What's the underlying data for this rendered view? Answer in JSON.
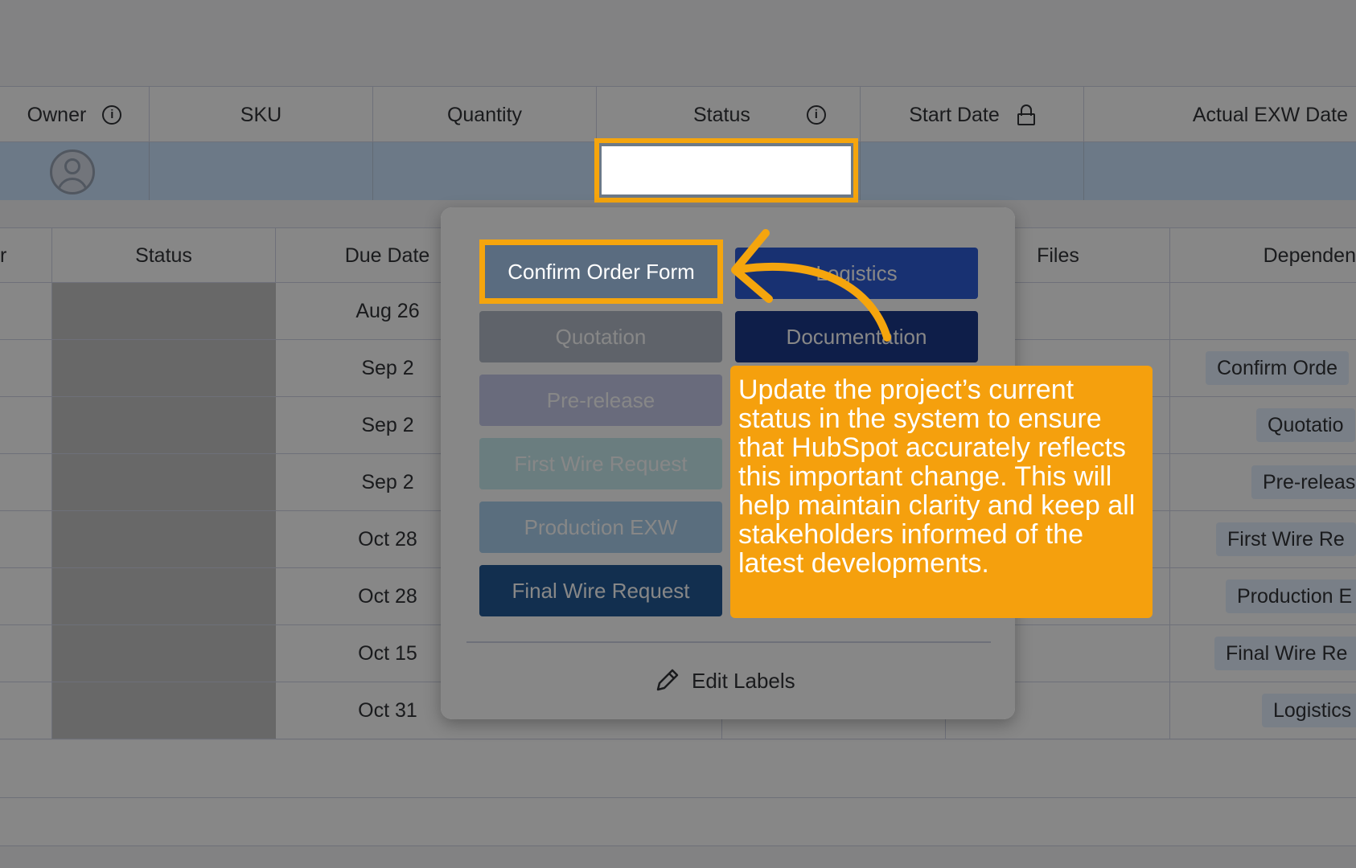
{
  "top_table": {
    "headers": {
      "owner": "Owner",
      "sku": "SKU",
      "quantity": "Quantity",
      "status": "Status",
      "start_date": "Start Date",
      "actual_exw": "Actual EXW Date"
    }
  },
  "sub_table": {
    "headers": {
      "r": "r",
      "status": "Status",
      "due_date": "Due Date",
      "files": "Files",
      "dependencies": "Dependen"
    },
    "rows": [
      {
        "due": "Aug 26",
        "dep": ""
      },
      {
        "due": "Sep 2",
        "dep": "Confirm Orde"
      },
      {
        "due": "Sep 2",
        "dep": "Quotatio"
      },
      {
        "due": "Sep 2",
        "dep": "Pre-releas"
      },
      {
        "due": "Oct 28",
        "dep": "First Wire Re"
      },
      {
        "due": "Oct 28",
        "dep": "Production E"
      },
      {
        "due": "Oct 15",
        "dep": "Final Wire Re"
      },
      {
        "due": "Oct 31",
        "dep": "Logistics"
      }
    ]
  },
  "popup": {
    "labels": [
      {
        "text": "Confirm Order Form",
        "color": "#5a6c80"
      },
      {
        "text": "Logistics",
        "color": "#2f5ed8"
      },
      {
        "text": "Quotation",
        "color": "#b4bcc8"
      },
      {
        "text": "Documentation",
        "color": "#1c3a8a"
      },
      {
        "text": "Pre-release",
        "color": "#c7cbeb"
      },
      {
        "text": "First Wire Request",
        "color": "#c8ecf0"
      },
      {
        "text": "Production EXW",
        "color": "#aad0ee"
      },
      {
        "text": "Final Wire Request",
        "color": "#225a96"
      }
    ],
    "edit_labels": "Edit Labels"
  },
  "annotation": {
    "callout": "Update the project’s current status in the system to ensure that HubSpot accurately reflects this important change. This will help maintain clarity and keep all stakeholders informed of the latest developments.",
    "highlight_color": "#f5a50d"
  }
}
